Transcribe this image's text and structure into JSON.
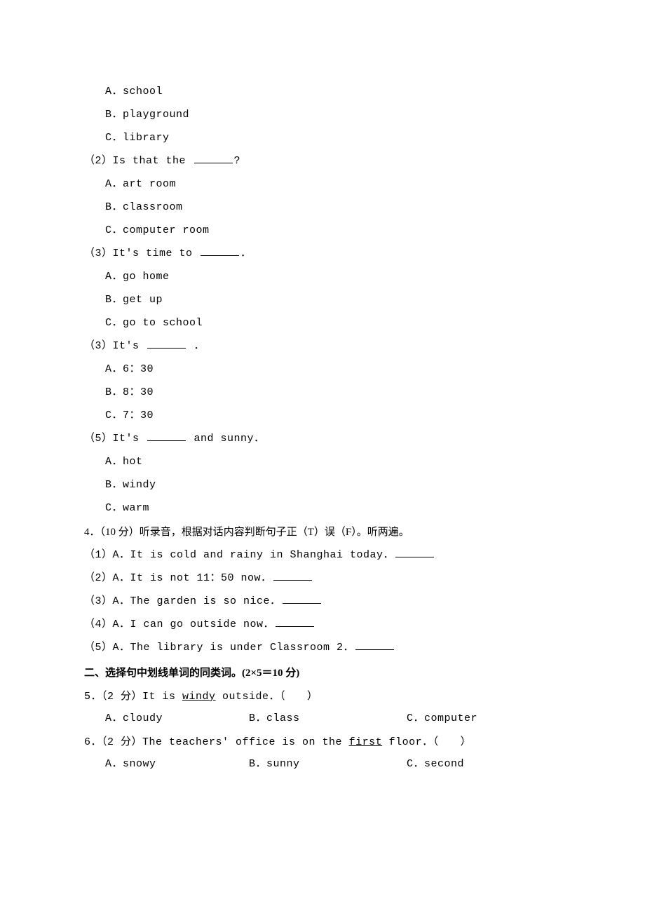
{
  "q3": {
    "sub1": {
      "A": "A．school",
      "B": "B．playground",
      "C": "C．library"
    },
    "sub2": {
      "prompt_pre": "（2）Is that the ",
      "prompt_post": "?",
      "A": "A．art room",
      "B": "B．classroom",
      "C": "C．computer room"
    },
    "sub3": {
      "prompt_pre": "（3）It's time to ",
      "prompt_post": "．",
      "A": "A．go home",
      "B": "B．get up",
      "C": "C．go to school"
    },
    "sub4": {
      "prompt_pre": "（3）It's ",
      "prompt_post": " ．",
      "A": "A．6：30",
      "B": "B．8：30",
      "C": "C．7：30"
    },
    "sub5": {
      "prompt_pre": "（5）It's ",
      "prompt_post": " and sunny．",
      "A": "A．hot",
      "B": "B．windy",
      "C": "C．warm"
    }
  },
  "q4": {
    "header": "4．（10 分）听录音，根据对话内容判断句子正（T）误（F）。听两遍。",
    "items": {
      "1": "（1）A．It is cold and rainy in Shanghai today．",
      "2": "（2）A．It is not 11：50 now．",
      "3": "（3）A．The garden is so nice．",
      "4": "（4）A．I can go outside now．",
      "5": "（5）A．The library is under Classroom 2．"
    }
  },
  "section2": {
    "heading": "二、选择句中划线单词的同类词。(2×5＝10 分)"
  },
  "q5": {
    "header_a": "5．（2 分）It is ",
    "underlined": "windy",
    "header_b": " outside．（　　）",
    "A": "A．cloudy",
    "B": "B．class",
    "C": "C．computer"
  },
  "q6": {
    "header_a": "6．（2 分）The teachers' office is on the ",
    "underlined": "first",
    "header_b": " floor．（　　）",
    "A": "A．snowy",
    "B": "B．sunny",
    "C": "C．second"
  }
}
